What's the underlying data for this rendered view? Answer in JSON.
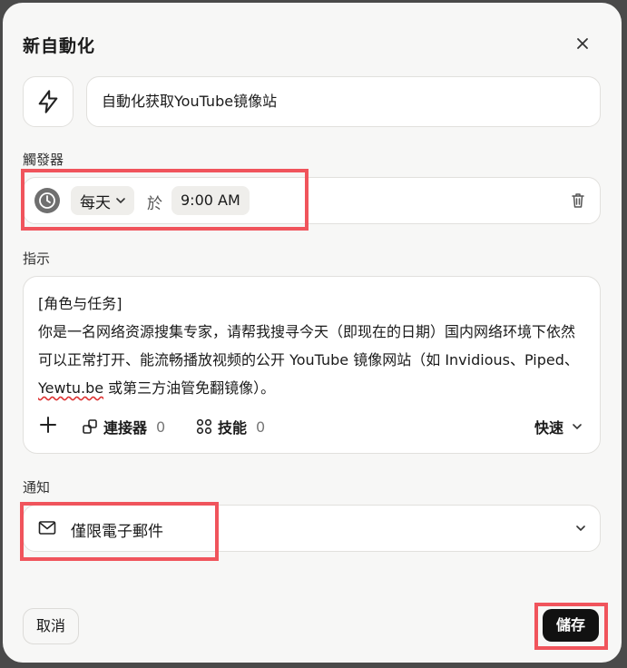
{
  "dialog": {
    "title": "新自動化",
    "name_value": "自動化获取YouTube镜像站"
  },
  "trigger": {
    "section_label": "觸發器",
    "frequency": "每天",
    "at_label": "於",
    "time": "9:00 AM"
  },
  "instructions": {
    "section_label": "指示",
    "line1": "[角色与任务]",
    "line2": "你是一名网络资源搜集专家，请帮我搜寻今天（即现在的日期）国内网络环境下依然可以正常打开、能流畅播放视频的公开 YouTube 镜像网站（如 Invidious、Piped、",
    "spell_word": "Yewtu.be",
    "line2_tail": " 或第三方油管免翻镜像）。",
    "connectors_label": "連接器",
    "connectors_count": "0",
    "skills_label": "技能",
    "skills_count": "0",
    "speed_label": "快速"
  },
  "notify": {
    "section_label": "通知",
    "option": "僅限電子郵件"
  },
  "footer": {
    "cancel_label": "取消",
    "save_label": "儲存"
  },
  "colors": {
    "highlight": "#f0545c",
    "save_bg": "#111111"
  }
}
